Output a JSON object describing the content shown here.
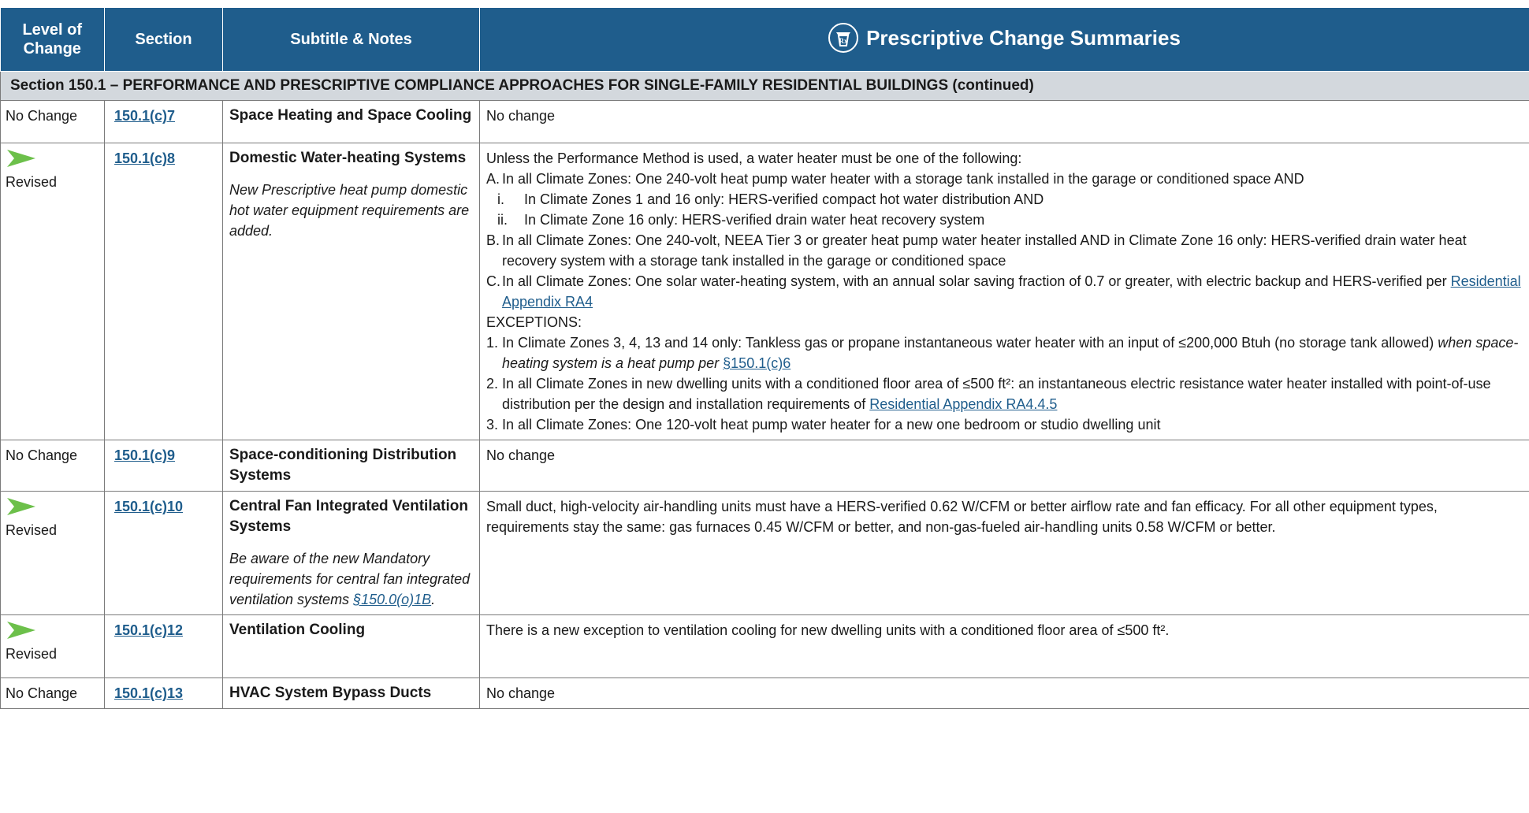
{
  "header": {
    "col_level": "Level of Change",
    "col_section": "Section",
    "col_subtitle": "Subtitle & Notes",
    "col_summary": "Prescriptive Change Summaries",
    "summary_icon": "rx-icon"
  },
  "section_row": "Section 150.1 – PERFORMANCE AND PRESCRIPTIVE COMPLIANCE APPROACHES FOR SINGLE-FAMILY RESIDENTIAL BUILDINGS (continued)",
  "rows": [
    {
      "level": "No Change",
      "code": "150.1(c)7",
      "title": "Space Heating and Space Cooling",
      "summary": "No change"
    },
    {
      "level": "Revised",
      "code": "150.1(c)8",
      "title": "Domestic Water-heating Systems",
      "note": "New Prescriptive heat pump domestic hot water equipment requirements are added.",
      "intro": "Unless the Performance Method is used, a water heater must be one of the following:",
      "a_marker": "A.",
      "a_text": "In all Climate Zones: One 240-volt heat pump water heater with a storage tank installed in the garage or conditioned space AND",
      "ai_marker": "i.",
      "ai_text": "In Climate Zones 1 and 16 only: HERS-verified compact hot water distribution  AND",
      "aii_marker": "ii.",
      "aii_text": "In Climate Zone 16 only: HERS-verified drain water heat recovery system",
      "b_marker": "B.",
      "b_text": "In all Climate Zones: One 240-volt, NEEA Tier 3 or greater heat pump water heater installed AND in Climate Zone 16 only: HERS-verified drain water heat recovery system with a storage tank installed in the garage or conditioned space",
      "c_marker": "C.",
      "c_text": "In all Climate Zones: One solar water-heating system, with an annual solar saving fraction of 0.7 or greater, with electric backup and HERS-verified per ",
      "c_link": "Residential Appendix RA4",
      "exceptions_label": "EXCEPTIONS:",
      "e1_marker": "1.",
      "e1_text": "In Climate Zones 3, 4, 13 and 14 only: Tankless gas or propane instantaneous water heater with an input of ≤200,000 Btuh (no storage tank allowed) ",
      "e1_italic": "when space-heating system is a heat pump per ",
      "e1_link": "§150.1(c)6",
      "e2_marker": "2.",
      "e2_text": "In all Climate Zones in new dwelling units with a conditioned floor area of ≤500 ft²: an instantaneous electric resistance water heater installed with point-of-use distribution per the design and installation requirements of ",
      "e2_link": "Residential Appendix RA4.4.5 ",
      "e3_marker": "3.",
      "e3_text": "In all Climate Zones: One 120-volt heat pump water heater for a new one bedroom or studio dwelling unit"
    },
    {
      "level": "No Change",
      "code": "150.1(c)9",
      "title": "Space-conditioning Distribution Systems",
      "summary": "No change"
    },
    {
      "level": "Revised",
      "code": "150.1(c)10",
      "title": "Central Fan Integrated Ventilation Systems",
      "note": "Be aware of the new Mandatory requirements for central fan integrated ventilation systems ",
      "note_link": "§150.0(o)1B",
      "note_end": ".",
      "summary": "Small duct, high-velocity air-handling units must have a HERS-verified 0.62 W/CFM or better airflow rate and fan efficacy. For all other equipment types, requirements stay the same: gas furnaces 0.45 W/CFM or better, and non-gas-fueled air-handling units 0.58 W/CFM or better."
    },
    {
      "level": "Revised",
      "code": "150.1(c)12",
      "title": "Ventilation Cooling",
      "summary": "There is a new exception to ventilation cooling for new dwelling units with a conditioned floor area of ≤500 ft²."
    },
    {
      "level": "No Change",
      "code": "150.1(c)13",
      "title": "HVAC System Bypass Ducts",
      "summary": "No change"
    }
  ],
  "colors": {
    "header_bg": "#1f5d8c",
    "section_bg": "#d3d8dd",
    "arrow": "#6cc04a",
    "link": "#1f5d8c"
  }
}
